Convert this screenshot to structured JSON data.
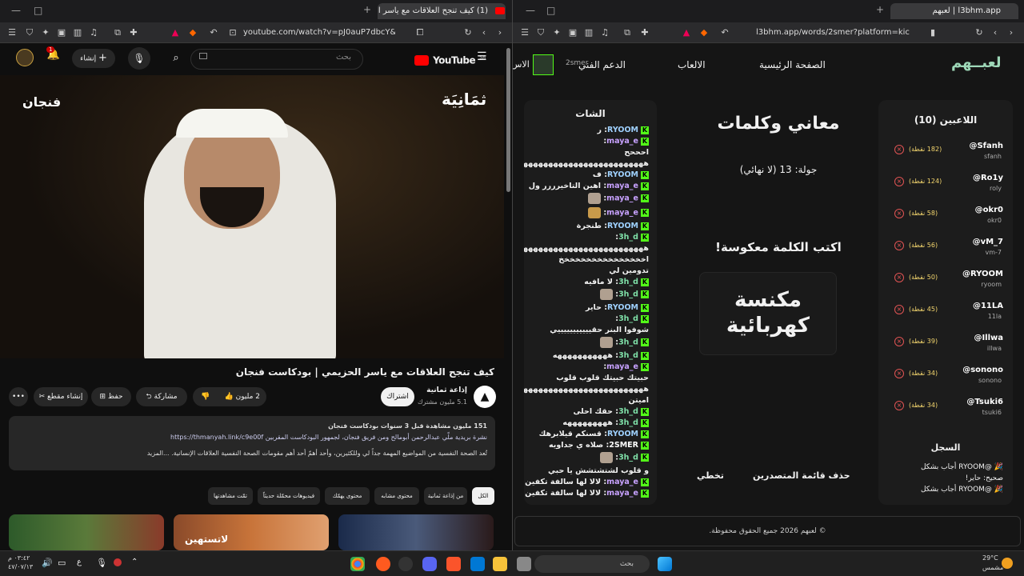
{
  "left_window": {
    "tab_title": "(1) كيف تنجح العلاقات مع ياسر ا",
    "url": "youtube.com/watch?v=pJ0auP7dbcY&t=8...",
    "youtube": {
      "logo": "YouTube",
      "logo_region": "SA",
      "search_placeholder": "بحث",
      "create_label": "إنشاء",
      "notif_count": "1",
      "video_overlay_left": "فنجان",
      "video_overlay_right": "ثمَانِيَة",
      "video_title": "كيف تنجح العلاقات مع ياسر الحزيمي | بودكاست فنجان",
      "channel_name": "إذاعة ثمانية",
      "subscribers": "5.1 مليون مشترك",
      "subscribe_label": "اشتراك",
      "likes": "2 مليون",
      "share_label": "مشاركة",
      "save_label": "حفظ",
      "clip_label": "إنشاء مقطع",
      "desc_line1": "151 مليون مشاهدة قبل 3 سنوات  بودكاست فنجان",
      "desc_line2": "نشرة بريدية ملّي عبدالرحمن أبومالح ومن فريق فنجان، لجمهور البودكاست المقربين https://thmanyah.link/c9e00f",
      "desc_line3": "تُعد الصحة النفسية من المواضيع المهمة جداً لي وللكثيرين، وأحد أهمّ أحد أهم مقومات الصحة النفسية العلاقات الإنسانية. ...المزيد",
      "chips": [
        "الكل",
        "من إذاعة ثمانية",
        "محتوى مشابه",
        "محتوى يهمّك",
        "فيديوهات محمّلة حديثاً",
        "تمّت مشاهدتها"
      ],
      "thumb_text": "لاتستهين"
    }
  },
  "right_window": {
    "tab_title": "لعبهم | l3bhm.app",
    "url": "l3bhm.app/words/2smer?platform=kick",
    "logo": "لعبــهم",
    "nav": [
      "الصفحة الرئيسية",
      "الالعاب",
      "الدعم الفني"
    ],
    "nav_user": "2smer",
    "nav_cut": "الاس",
    "players_title": "اللاعبين (10)",
    "players": [
      {
        "name": "@Sfanh",
        "user": "sfanh",
        "points": "(182 نقطة)"
      },
      {
        "name": "@Ro1y",
        "user": "roly",
        "points": "(124 نقطة)"
      },
      {
        "name": "@okr0",
        "user": "okr0",
        "points": "(58 نقطة)"
      },
      {
        "name": "@vM_7",
        "user": "vm-7",
        "points": "(56 نقطة)"
      },
      {
        "name": "@RYOOM",
        "user": "ryoom",
        "points": "(50 نقطة)"
      },
      {
        "name": "@11LA",
        "user": "11la",
        "points": "(45 نقطة)"
      },
      {
        "name": "@Illwa",
        "user": "illwa",
        "points": "(39 نقطة)"
      },
      {
        "name": "@sonono",
        "user": "sonono",
        "points": "(34 نقطة)"
      },
      {
        "name": "@Tsuki6",
        "user": "tsuki6",
        "points": "(34 نقطة)"
      }
    ],
    "log_title": "السجل",
    "log": [
      "🎉 @RYOOM أجاب بشكل",
      "صحيح: حاير!",
      "🎉 @RYOOM أجاب بشكل"
    ],
    "game_title": "معاني وكلمات",
    "round": "جولة: 13 (لا نهائي)",
    "instruction": "اكتب الكلمة معكوسة!",
    "word": "مكنسة كهربائية",
    "btn_clear": "حذف قائمة المتصدرين",
    "btn_skip": "تخطي",
    "chat_title": "الشات",
    "chat": [
      {
        "user": "RYOOM",
        "msg": "ر"
      },
      {
        "user": "maya_e",
        "msg": ""
      },
      {
        "user": "",
        "msg": "احححح"
      },
      {
        "user": "",
        "msg": "هههههههههههههههههههههههههههههه دوم دوم"
      },
      {
        "user": "RYOOM",
        "msg": "ف"
      },
      {
        "user": "maya_e",
        "msg": "اهين التاخيرررر ول"
      },
      {
        "user": "maya_e",
        "msg": "",
        "emote": true
      },
      {
        "user": "maya_e",
        "msg": "",
        "emote": true
      },
      {
        "user": "RYOOM",
        "msg": "طنجرة"
      },
      {
        "user": "3h_d",
        "msg": ""
      },
      {
        "user": "",
        "msg": "ههههههههههههههههههههههههههه"
      },
      {
        "user": "",
        "msg": "اخخخخخخخخخخخخخخخخ"
      },
      {
        "user": "",
        "msg": "تدومين لي"
      },
      {
        "user": "3h_d",
        "msg": "لا مافيه"
      },
      {
        "user": "3h_d",
        "msg": "",
        "emote": true
      },
      {
        "user": "RYOOM",
        "msg": "حاير"
      },
      {
        "user": "3h_d",
        "msg": ""
      },
      {
        "user": "",
        "msg": "شوفوا البنر حقيييييييييييي"
      },
      {
        "user": "3h_d",
        "msg": "",
        "emote": true
      },
      {
        "user": "3h_d",
        "msg": "هههههههههههه"
      },
      {
        "user": "maya_e",
        "msg": ""
      },
      {
        "user": "",
        "msg": "حبيتك حبيتك قلوب قلوب"
      },
      {
        "user": "",
        "msg": "هههههههههههههههههههههههههههه"
      },
      {
        "user": "",
        "msg": "اميتن"
      },
      {
        "user": "3h_d",
        "msg": "حقك احلى"
      },
      {
        "user": "3h_d",
        "msg": "هههههههههه"
      },
      {
        "user": "RYOOM",
        "msg": "قسنكم قيلابرهك"
      },
      {
        "user": "2SMER",
        "msg": "صلاه ي جداويه"
      },
      {
        "user": "3h_d",
        "msg": "",
        "emote": true
      },
      {
        "user": "",
        "msg": "و قلوب لشتشتشش يا حبي"
      },
      {
        "user": "maya_e",
        "msg": "لالا لها سالفة تكفين ه"
      },
      {
        "user": "maya_e",
        "msg": "لالا لها سالفة تكفين ه"
      }
    ],
    "footer": "© لعبهم 2026 جميع الحقوق محفوظة."
  },
  "taskbar": {
    "time": "٠٣:٤٢ م",
    "date": "٤٧/٠٧/١٣",
    "search_placeholder": "بحث",
    "weather_temp": "29°C",
    "weather_desc": "مشمس",
    "lang": "ع"
  }
}
